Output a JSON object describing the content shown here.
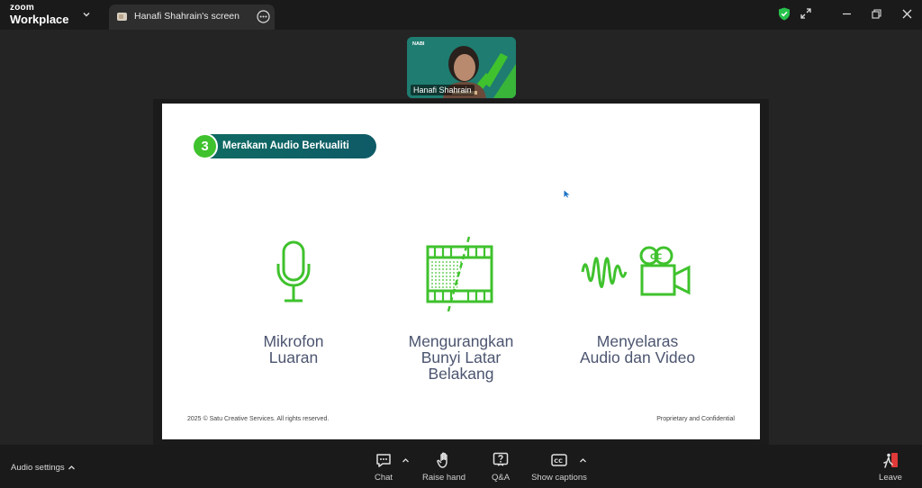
{
  "app": {
    "brand_top": "zoom",
    "brand_bottom": "Workplace"
  },
  "tab": {
    "title": "Hanafi Shahrain's screen"
  },
  "video": {
    "participant_name": "Hanafi Shahrain",
    "logo_text": "NABI"
  },
  "slide": {
    "section_number": "3",
    "section_title": "Merakam Audio Berkualiti",
    "features": [
      {
        "line1": "Mikrofon",
        "line2": "Luaran",
        "line3": "",
        "icon": "microphone-icon"
      },
      {
        "line1": "Mengurangkan",
        "line2": "Bunyi Latar",
        "line3": "Belakang",
        "icon": "film-noise-icon"
      },
      {
        "line1": "Menyelaras",
        "line2": "Audio dan Video",
        "line3": "",
        "icon": "sound-camera-icon"
      }
    ],
    "footer_left": "2025 © Satu Creative Services. All rights reserved.",
    "footer_right": "Proprietary and Confidential"
  },
  "toolbar": {
    "audio_settings": "Audio settings",
    "chat": "Chat",
    "raise_hand": "Raise hand",
    "qa": "Q&A",
    "show_captions": "Show captions",
    "leave": "Leave"
  },
  "colors": {
    "accent_green": "#3fc22d",
    "pill_teal": "#0f6c62",
    "label_slate": "#4c5570",
    "shield_green": "#27c24c",
    "leave_red": "#e03a3a"
  }
}
